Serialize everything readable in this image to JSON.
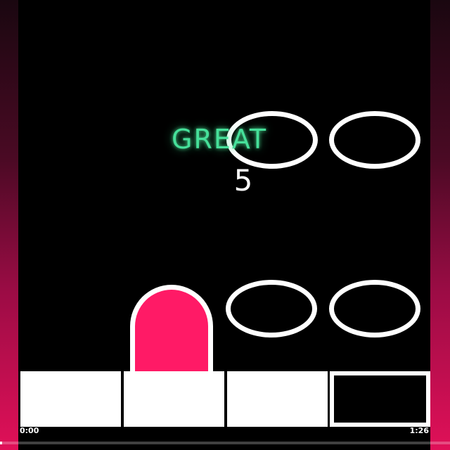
{
  "game": {
    "judgement": "GREAT",
    "combo": "5"
  },
  "lanes": [
    {
      "key_state": "pressed"
    },
    {
      "key_state": "pressed"
    },
    {
      "key_state": "pressed"
    },
    {
      "key_state": "empty"
    }
  ],
  "notes": [
    {
      "lane": 3,
      "row": "upper",
      "type": "tap"
    },
    {
      "lane": 4,
      "row": "upper",
      "type": "tap"
    },
    {
      "lane": 2,
      "row": "lower",
      "type": "hold",
      "color": "#ff1a66"
    },
    {
      "lane": 3,
      "row": "lower",
      "type": "tap"
    },
    {
      "lane": 4,
      "row": "lower",
      "type": "tap"
    }
  ],
  "player": {
    "current_time": "0:00",
    "total_time": "1:26",
    "progress": 0.0
  },
  "colors": {
    "judgement_glow": "#46e09a",
    "hold_note": "#ff1a66",
    "background_gradient_bottom": "#e01058"
  }
}
